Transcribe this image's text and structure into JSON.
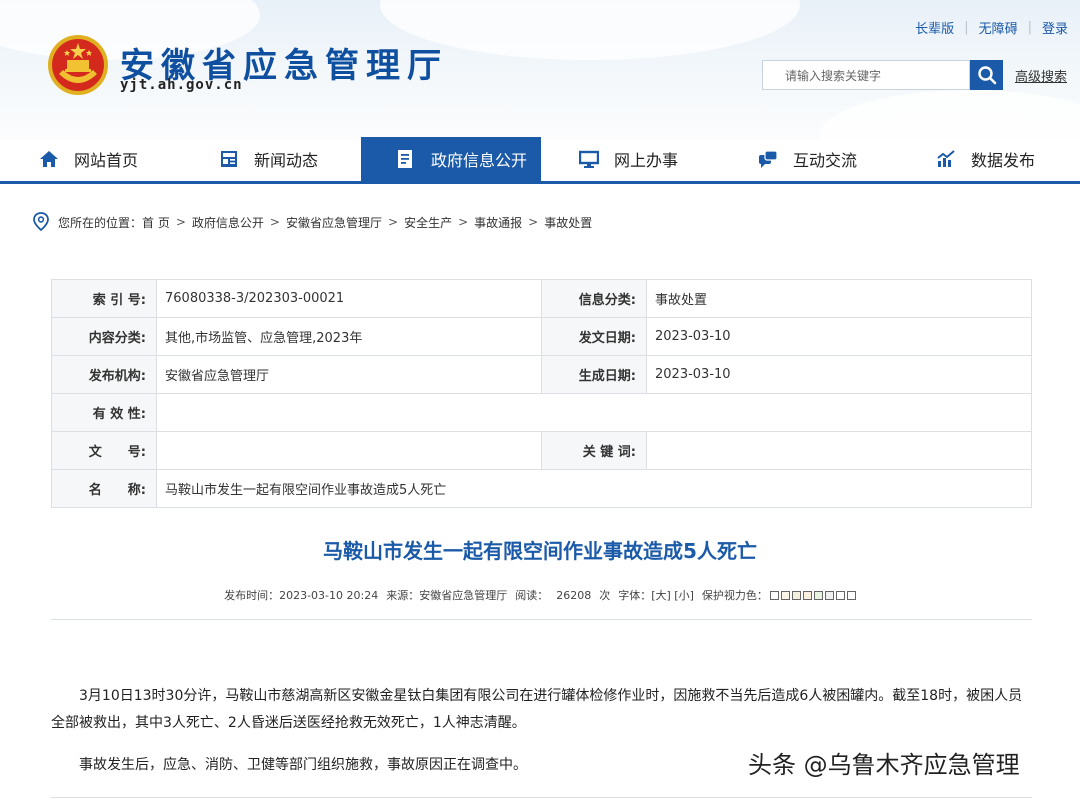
{
  "header": {
    "top_links": [
      "长辈版",
      "无障碍",
      "登录"
    ],
    "site_title": "安徽省应急管理厅",
    "site_domain": "yjt.ah.gov.cn",
    "search_placeholder": "请输入搜索关键字",
    "advanced_search": "高级搜索"
  },
  "nav": {
    "items": [
      {
        "label": "网站首页",
        "icon": "home-icon"
      },
      {
        "label": "新闻动态",
        "icon": "news-icon"
      },
      {
        "label": "政府信息公开",
        "icon": "document-icon",
        "active": true
      },
      {
        "label": "网上办事",
        "icon": "monitor-icon"
      },
      {
        "label": "互动交流",
        "icon": "chat-icon"
      },
      {
        "label": "数据发布",
        "icon": "chart-icon"
      }
    ],
    "accent_color": "#1a5aa8"
  },
  "breadcrumb": {
    "prefix": "您所在的位置：",
    "items": [
      "首 页",
      "政府信息公开",
      "安徽省应急管理厅",
      "安全生产",
      "事故通报",
      "事故处置"
    ]
  },
  "info": {
    "index_label": "索 引 号:",
    "index_value": "76080338-3/202303-00021",
    "category_label": "信息分类:",
    "category_value": "事故处置",
    "content_label": "内容分类:",
    "content_value": "其他,市场监管、应急管理,2023年",
    "issue_date_label": "发文日期:",
    "issue_date_value": "2023-03-10",
    "org_label": "发布机构:",
    "org_value": "安徽省应急管理厅",
    "gen_date_label": "生成日期:",
    "gen_date_value": "2023-03-10",
    "validity_label": "有 效 性:",
    "validity_value": "",
    "doc_no_label": "文　　号:",
    "doc_no_value": "",
    "keywords_label": "关 键 词:",
    "keywords_value": "",
    "name_label": "名　　称:",
    "name_value": "马鞍山市发生一起有限空间作业事故造成5人死亡"
  },
  "article": {
    "title": "马鞍山市发生一起有限空间作业事故造成5人死亡",
    "publish_time": "发布时间：2023-03-10 20:24",
    "source": "来源：安徽省应急管理厅",
    "reads_label": "阅读：",
    "reads_value": "26208",
    "reads_unit": "次",
    "font_size": "字体：[大] [小]",
    "eye_protect": "保护视力色：",
    "paragraph1": "3月10日13时30分许，马鞍山市慈湖高新区安徽金星钛白集团有限公司在进行罐体检修作业时，因施救不当先后造成6人被困罐内。截至18时，被困人员全部被救出，其中3人死亡、2人昏迷后送医经抢救无效死亡，1人神志清醒。",
    "paragraph2": "事故发生后，应急、消防、卫健等部门组织施救，事故原因正在调查中。"
  },
  "watermark": "头条 @乌鲁木齐应急管理"
}
